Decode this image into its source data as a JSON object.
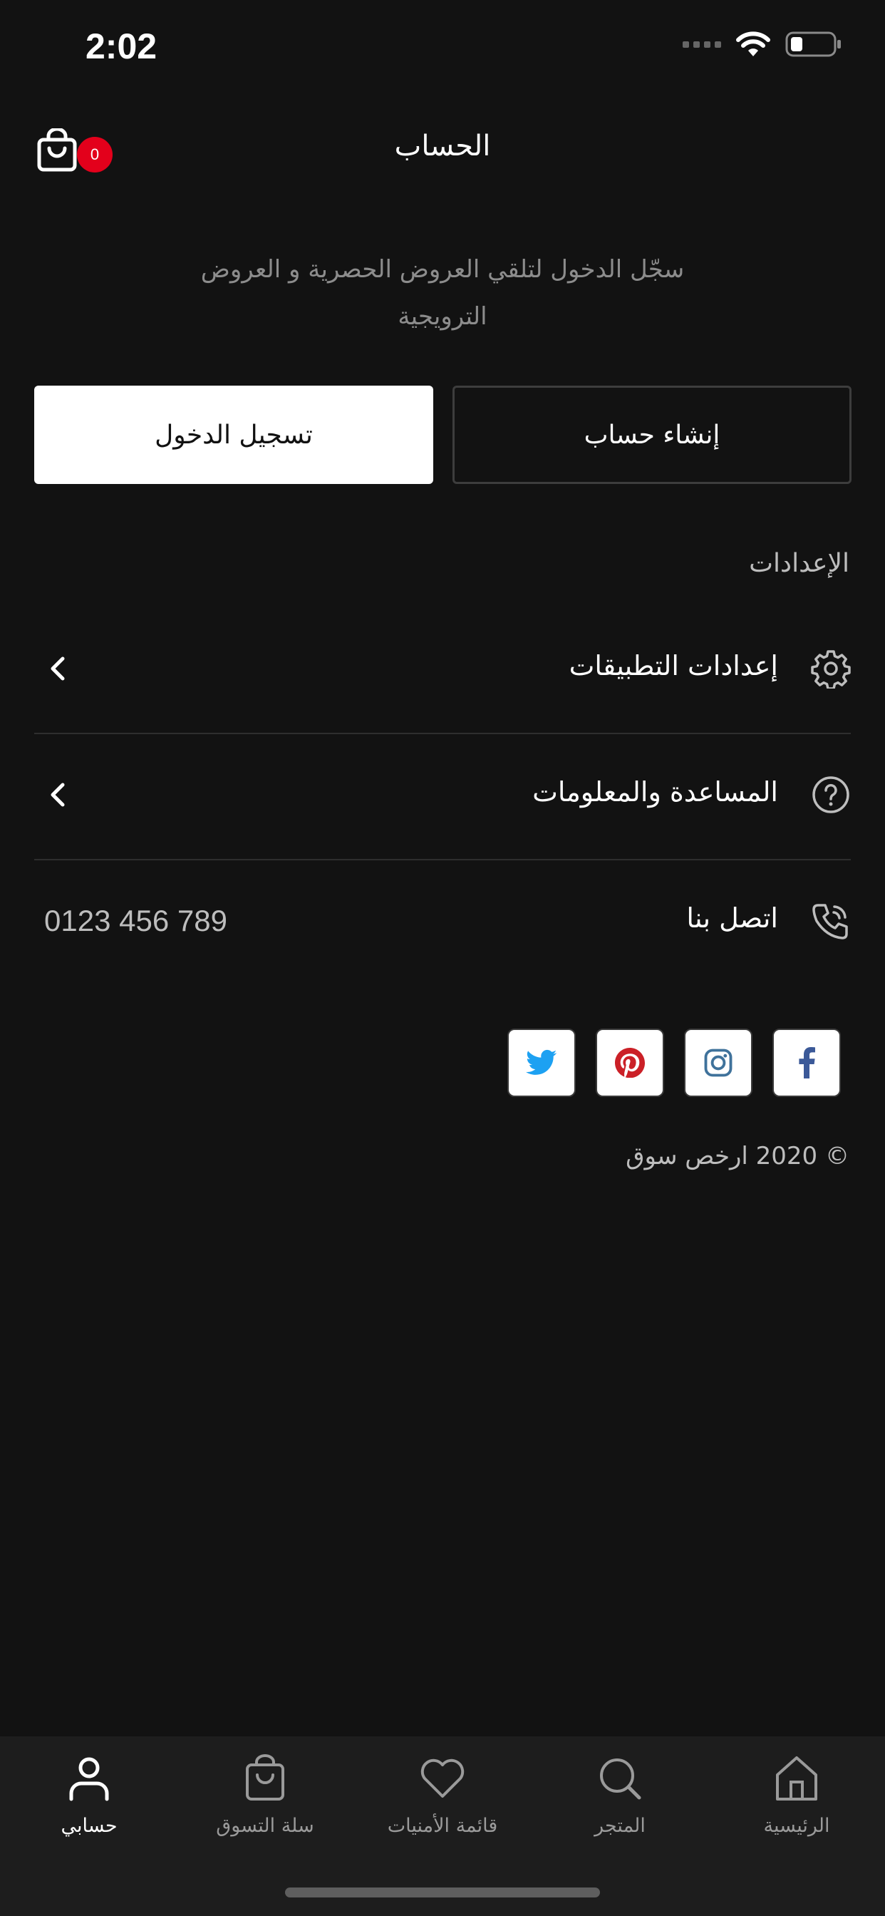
{
  "status_bar": {
    "time": "2:02"
  },
  "header": {
    "title": "الحساب",
    "cart_count": "0"
  },
  "promo": {
    "text": "سجّل الدخول لتلقي العروض الحصرية و العروض الترويجية"
  },
  "buttons": {
    "login": "تسجيل الدخول",
    "create_account": "إنشاء حساب"
  },
  "settings": {
    "section_label": "الإعدادات",
    "items": [
      {
        "label": "إعدادات التطبيقات",
        "icon": "gear-icon"
      },
      {
        "label": "المساعدة والمعلومات",
        "icon": "help-icon"
      },
      {
        "label": "اتصل بنا",
        "icon": "phone-icon",
        "value": "0123 456 789"
      }
    ]
  },
  "social": [
    "twitter",
    "pinterest",
    "instagram",
    "facebook"
  ],
  "footer": {
    "copyright": "© 2020 ارخص سوق"
  },
  "tab_bar": {
    "tabs": [
      {
        "label": "حسابي",
        "icon": "user-icon",
        "active": true
      },
      {
        "label": "سلة التسوق",
        "icon": "bag-icon"
      },
      {
        "label": "قائمة الأمنيات",
        "icon": "heart-icon"
      },
      {
        "label": "المتجر",
        "icon": "search-icon"
      },
      {
        "label": "الرئيسية",
        "icon": "home-icon"
      }
    ]
  },
  "colors": {
    "background": "#121212",
    "badge": "#e3001b",
    "twitter": "#1da1f2",
    "pinterest": "#cb2027",
    "instagram": "#3f729b",
    "facebook": "#3b5998"
  }
}
